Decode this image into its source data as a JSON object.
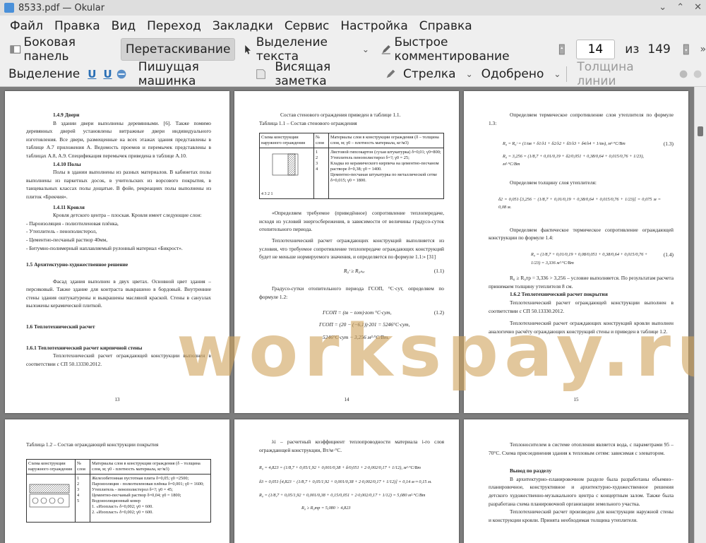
{
  "window": {
    "title": "8533.pdf — Okular"
  },
  "menu": [
    "Файл",
    "Правка",
    "Вид",
    "Переход",
    "Закладки",
    "Сервис",
    "Настройка",
    "Справка"
  ],
  "toolbar1": {
    "sidebar": "Боковая панель",
    "drag": "Перетаскивание",
    "text_select": "Выделение текста",
    "quick_comment": "Быстрое комментирование",
    "page_current": "14",
    "page_of": "из",
    "page_total": "149"
  },
  "toolbar2": {
    "selection": "Выделение",
    "typewriter": "Пишущая машинка",
    "pinned_note": "Висящая заметка",
    "arrow": "Стрелка",
    "approved": "Одобрено",
    "line_width": "Толщина линии"
  },
  "watermark": "workspay.ru",
  "pages": {
    "p13": {
      "h_doors": "1.4.9 Двери",
      "doors": "В здании двери выполнены деревянными. [6]. Также помимо деревянных дверей установлены витражные двери индивидуального изготовления. Все двери, размещенные на всех этажах здания представлены в таблице А.7 приложения А. Ведомость проемов и перемычек представлены в таблицах А.8, А.9. Спецификация перемычек приведена в таблице А.10.",
      "h_floors": "1.4.10 Полы",
      "floors": "Полы в здании выполнены из разных материалов. В кабинетах полы выполнены из паркетных досок, в учительских из ворсового покрытия, в танцевальных классах полы дощатые. В фойе, рекреациях полы выполнены из плиток «Брекчия».",
      "h_roof": "1.4.11 Кровля",
      "roof": "Кровля детского центра – плоская. Кровля имеет следующие слои:",
      "roof_layers": [
        "- Пароизоляция - полиэтиленовая плёнка,",
        "- Утеплитель - пенополистерол,",
        "- Цементно-песчаный раствор 40мм,",
        "- Битумно-полимерный наплавляемый рулонный материал «Бикрост»."
      ],
      "h_arch": "1.5 Архитектурно-художественное решение",
      "arch": "Фасад здания выполнен в двух цветах. Основной цвет здания – персиковый. Также здание для контраста выкрашено в бордовый. Внутренние стены здания оштукатурены и выкрашены масляной краской. Стены в санузлах выложены керамической плиткой.",
      "h_thermal": "1.6 Теплотехнический расчет",
      "h_brick": "1.6.1 Теплотехнический расчет кирпичной стены",
      "brick": "Теплотехнический расчет ограждающей конструкции выполнен в соответствии с СП 50.13330.2012.",
      "num": "13"
    },
    "p14": {
      "intro": "Состав стенового ограждения приведен в таблице 1.1.",
      "caption": "Таблица 1.1 – Состав стенового ограждения",
      "th1": "Схема конструкции наружного ограждения",
      "th2": "№ слоя",
      "th3": "Материалы слоя в конструкции ограждения (δ – толщина слоя, м; γ0 – плотность материала, кг/м3)",
      "layers_nums": "1\n2\n3\n4",
      "layers": "Листовой гипсокартон (сухая штукатурка) δ=0,01; γ0=800;\nУтеплитель пенополистирол δ=?; γ0 = 25;\nКладка из керамического кирпича на цементно-песчаном растворе δ=0,38; γ0 = 1400.\nЦементно-песчаная штукатурка по металлической сетке δ=0,015; γ0 = 1800.",
      "scheme_label": "4 3 2 1",
      "p1": "«Определяем требуемое (приведённое) сопротивление теплопередаче, исходя из условий энергосбережения, в зависимости от величины градусо-суток отопительного периода.",
      "p2": "Теплотехнический расчет ограждающих конструкций выполняется из условия, что требуемое сопротивление теплопередаче ограждающих конструкций будет не меньше нормируемого значения, и определяется по формуле 1.1:» [31]",
      "f1": "R₀ᶦ ≥ R₀ₙₒᵣ",
      "f1n": "(1.1)",
      "p3": "Градусо-сутки отопительного периода ГСОП, °С·сут, определяем по формуле 1.2:",
      "f2": "ГСОП = (tв − tот)·zот °C·сут,",
      "f2n": "(1.2)",
      "f3": "ГСОП = (20 − (−6,1))·201 = 5246°C·сут,",
      "f4": "5246°C·сут − 3,256 м²·°C/Вт.",
      "num": "14"
    },
    "p15": {
      "p1": "Определяем термическое сопротивление слоя утеплителя по формуле 1.3:",
      "f1": "R₀ = R₀ᶦ = (1/αв + δ1/λ1 + δ2/λ2 + δ3/λ3 + δ4/λ4 + 1/αн), м²·°C/Вт",
      "f1n": "(1.3)",
      "f2": "R₀ = 3,256 = (1/8,7 + 0,01/0,19 + δ2/0,051 + 0,38/0,64 + 0,015/0,76 + 1/23), м²·°C/Вт",
      "p2": "Определяем толщину слоя утеплителя:",
      "f3": "δ2 = 0,051·[3,256 − (1/8,7 + 0,01/0,19 + 0,38/0,64 + 0,015/0,76 + 1/23)] = 0,075 м = 0,08 м.",
      "p3": "Определяем фактическое термическое сопротивление ограждающей конструкции по формуле 1.4:",
      "f4": "R₀ = (1/8,7 + 0,01/0,19 + 0,08/0,051 + 0,38/0,64 + 0,015/0,76 + 1/23) = 3,336 м²·°C/Вт",
      "f4n": "(1.4)",
      "p4": "R₀ ≥ R₀тр = 3,336 > 3,256 – условие выполняется. По результатам расчета принимаем толщину утеплителя 8 см.",
      "h_cover": "1.6.2 Теплотехнический расчет покрытия",
      "p5": "Теплотехнический расчет ограждающей конструкции выполнен в соответствии с СП 50.13330.2012.",
      "p6": "Теплотехнический расчет ограждающих конструкций кровли выполнен аналогично расчёту ограждающих конструкций стены и приведен в таблице 1.2.",
      "num": "15"
    },
    "p16": {
      "caption": "Таблица 1.2 – Состав ограждающей конструкции покрытия",
      "th1": "Схема конструкции наружного ограждения",
      "th2": "№ слоя",
      "th3": "Материалы слоя в конструкции ограждения (δ – толщина слоя, м; γ0 - плотность материала, кг/м3)",
      "layers_nums": "1\n2\n3\n4\n5",
      "layers": "Железобетонная пустотная плита δ=0,05; γ0 =2500;\nПароизоляция - полиэтиленовая плёнка δ=0,001; γ0 = 1600;\nУтеплитель - пенополистерол δ=?; γ0 = 45;\nЦементно-песчаный раствор δ=0,04; γ0 = 1800;\nВодоизоляционный ковер\n1. «Изопласт» δ=0,002; γ0 = 600.\n2. «Изопласт» δ=0,002; γ0 = 600."
    },
    "p17": {
      "p1": "λi – расчетный коэффициент теплопроводности материала i-го слоя ограждающей конструкции, Вт/м·°C.",
      "f1": "R₀ = 4,823 = (1/8,7 + 0,05/1,92 + 0,001/0,38 + δ/0,051 + 2·0,002/0,17 + 1/12), м²·°C/Вт",
      "f2": "δ3 = 0,051·[4,823 − (1/8,7 + 0,05/1,92 + 0,001/0,38 + 2·0,002/0,17 + 1/12)] = 0,14 м ≈ 0,15 м.",
      "f3": "R₀ = (1/8,7 + 0,05/1,92 + 0,001/0,38 + 0,15/0,051 + 2·0,002/0,17 + 1/12) = 5,080 м²·°C/Вт",
      "f4": "R₀ ≥ R₀тр = 5,080 > 4,823"
    },
    "p18": {
      "p1": "Теплоносителем в системе отопления является вода, с параметрами 95 – 70°С. Схема присоединения здания к тепловым сетям: зависимая с элеватором.",
      "h_concl": "Вывод по разделу",
      "p2": "В архитектурно–планировочном разделе была разработаны объемно–планировочное, конструктивное и архитектурно-художественное решения детского художественно-музыкального центра с концертным залом. Также была разработана схема планировочной организации земельного участка.",
      "p3": "Теплотехнический расчет произведен для конструкции наружной стены и конструкции кровли. Принята необходимая толщина утеплителя."
    }
  }
}
